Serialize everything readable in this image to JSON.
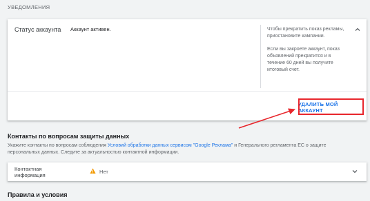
{
  "section": {
    "label": "УВЕДОМЛЕНИЯ"
  },
  "account_status": {
    "title": "Статус аккаунта",
    "value": "Аккаунт активен.",
    "help_paragraphs": [
      "Чтобы прекратить показ рекламы, приостановите кампании.",
      "Если вы закроете аккаунт, показ объявлений прекратится и в течение 60 дней вы получите итоговый счет."
    ],
    "delete_label": "УДАЛИТЬ МОЙ АККАУНТ"
  },
  "privacy": {
    "title": "Контакты по вопросам защиты данных",
    "desc_before": "Укажите контакты по вопросам соблюдения ",
    "desc_link": "Условий обработки данных сервисом \"Google Реклама\"",
    "desc_after": " и Генерального регламента ЕС о защите персональных данных. Следите за актуальностью контактной информации.",
    "contact_label": "Контактная информация",
    "contact_value": "Нет"
  },
  "terms": {
    "title": "Правила и условия"
  },
  "colors": {
    "accent": "#1a73e8",
    "highlight": "#e8262c",
    "warning": "#f29900"
  },
  "icons": {
    "collapse": "chevron-up-icon",
    "expand": "chevron-down-icon",
    "warning": "warning-icon"
  }
}
